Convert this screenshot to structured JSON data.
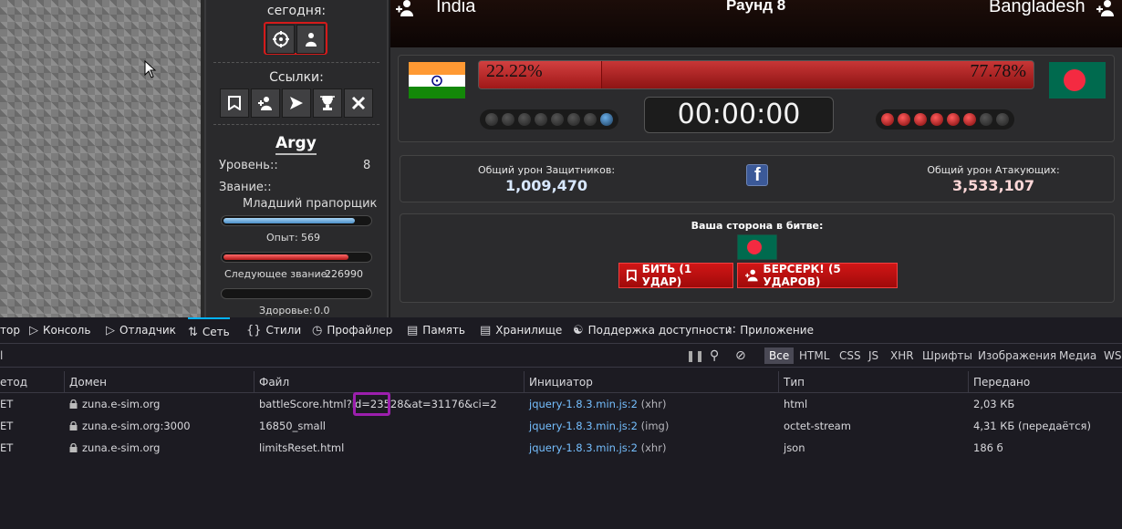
{
  "sidebar": {
    "today_label": "сегодня:",
    "links_label": "Ссылки:",
    "user_name": "Argy",
    "level_label": "Уровень::",
    "level_value": "8",
    "rank_label": "Звание::",
    "rank_value": "Младший прапорщик",
    "xp_label": "Опыт:",
    "xp_value": "569",
    "xp_fraction": 0.9,
    "next_rank_label": "Следующее звание:",
    "next_rank_value": "226990",
    "next_rank_fraction": 0.86,
    "health_label": "Здоровье:",
    "health_value": "0.0",
    "health_fraction": 0.0
  },
  "battle": {
    "defender": "India",
    "attacker": "Bangladesh",
    "round": "Раунд 8",
    "defender_pct": "22.22%",
    "attacker_pct": "77.78%",
    "defender_fraction": 0.2222,
    "timer": "00:00:00",
    "defender_rounds_won": 1,
    "attacker_rounds_won": 6,
    "defender_damage_label": "Общий урон Защитников:",
    "defender_damage": "1,009,470",
    "attacker_damage_label": "Общий урон Атакующих:",
    "attacker_damage": "3,533,107",
    "your_side_label": "Ваша сторона в битве:",
    "hit_button": "БИТЬ (1 УДАР)",
    "berserk_button": "БЕРСЕРК! (5 УДАРОВ)",
    "colors": {
      "bar_red": "#b82222",
      "flag_green": "#006a4e",
      "flag_red": "#f42a41"
    }
  },
  "devtools": {
    "tabs": [
      "тор",
      "Консоль",
      "Отладчик",
      "Сеть",
      "Стили",
      "Профайлер",
      "Память",
      "Хранилище",
      "Поддержка доступности",
      "Приложение"
    ],
    "filter_first": "l",
    "filters": [
      "Все",
      "HTML",
      "CSS",
      "JS",
      "XHR",
      "Шрифты",
      "Изображения",
      "Медиа",
      "WS"
    ],
    "columns": [
      "етод",
      "Домен",
      "Файл",
      "Инициатор",
      "Тип",
      "Передано"
    ],
    "rows": [
      {
        "method": "ET",
        "domain": "zuna.e-sim.org",
        "file": "battleScore.html?id=23528&at=31176&ci=2",
        "initiator": "jquery-1.8.3.min.js:2",
        "init_type": "(xhr)",
        "type": "html",
        "transferred": "2,03 КБ"
      },
      {
        "method": "ET",
        "domain": "zuna.e-sim.org:3000",
        "file": "16850_small",
        "initiator": "jquery-1.8.3.min.js:2",
        "init_type": "(img)",
        "type": "octet-stream",
        "transferred": "4,31 КБ (передаётся)"
      },
      {
        "method": "ET",
        "domain": "zuna.e-sim.org",
        "file": "limitsReset.html",
        "initiator": "jquery-1.8.3.min.js:2",
        "init_type": "(xhr)",
        "type": "json",
        "transferred": "186 б"
      }
    ]
  }
}
